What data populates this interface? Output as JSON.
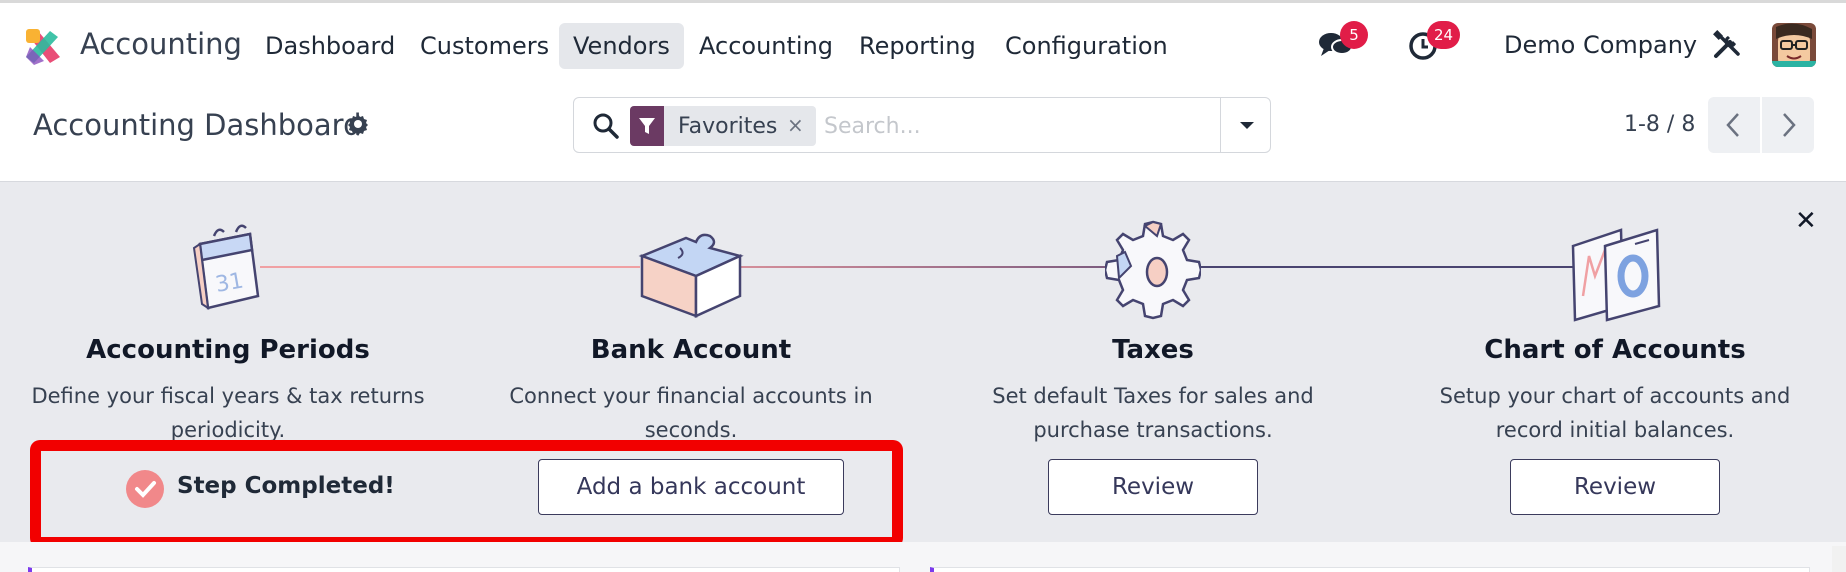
{
  "app": {
    "name": "Accounting"
  },
  "nav": {
    "items": [
      {
        "label": "Dashboard",
        "active": false
      },
      {
        "label": "Customers",
        "active": false
      },
      {
        "label": "Vendors",
        "active": true
      },
      {
        "label": "Accounting",
        "active": false
      },
      {
        "label": "Reporting",
        "active": false
      },
      {
        "label": "Configuration",
        "active": false
      }
    ]
  },
  "systray": {
    "messages_icon": "chat-bubbles-icon",
    "messages_count": "5",
    "activities_icon": "clock-icon",
    "activities_count": "24",
    "company": "Demo Company",
    "tools_icon": "tools-icon",
    "avatar_icon": "user-avatar"
  },
  "control_panel": {
    "title": "Accounting Dashboard",
    "settings_icon": "gear-icon",
    "search": {
      "facet_icon": "filter-icon",
      "facet_label": "Favorites",
      "facet_close": "×",
      "placeholder": "Search..."
    },
    "pager": {
      "value": "1-8 / 8"
    }
  },
  "onboarding": {
    "close_label": "✕",
    "steps": [
      {
        "icon": "calendar-icon",
        "icon_text": "31",
        "title": "Accounting Periods",
        "description": "Define your fiscal years & tax returns periodicity.",
        "status": "Step Completed!"
      },
      {
        "icon": "puzzle-piece-icon",
        "title": "Bank Account",
        "description": "Connect your financial accounts in seconds.",
        "button_label": "Add a bank account"
      },
      {
        "icon": "gear-icon",
        "title": "Taxes",
        "description": "Set default Taxes for sales and purchase transactions.",
        "button_label": "Review"
      },
      {
        "icon": "chart-cards-icon",
        "title": "Chart of Accounts",
        "description": "Setup your chart of accounts and record initial balances.",
        "button_label": "Review"
      }
    ]
  },
  "colors": {
    "accent": "#6b3a63",
    "badge": "#e11d48",
    "highlight": "#f20000",
    "connector_start": "#f2a5a5",
    "connector_end": "#4a4470",
    "step_button_text": "#35375a"
  }
}
